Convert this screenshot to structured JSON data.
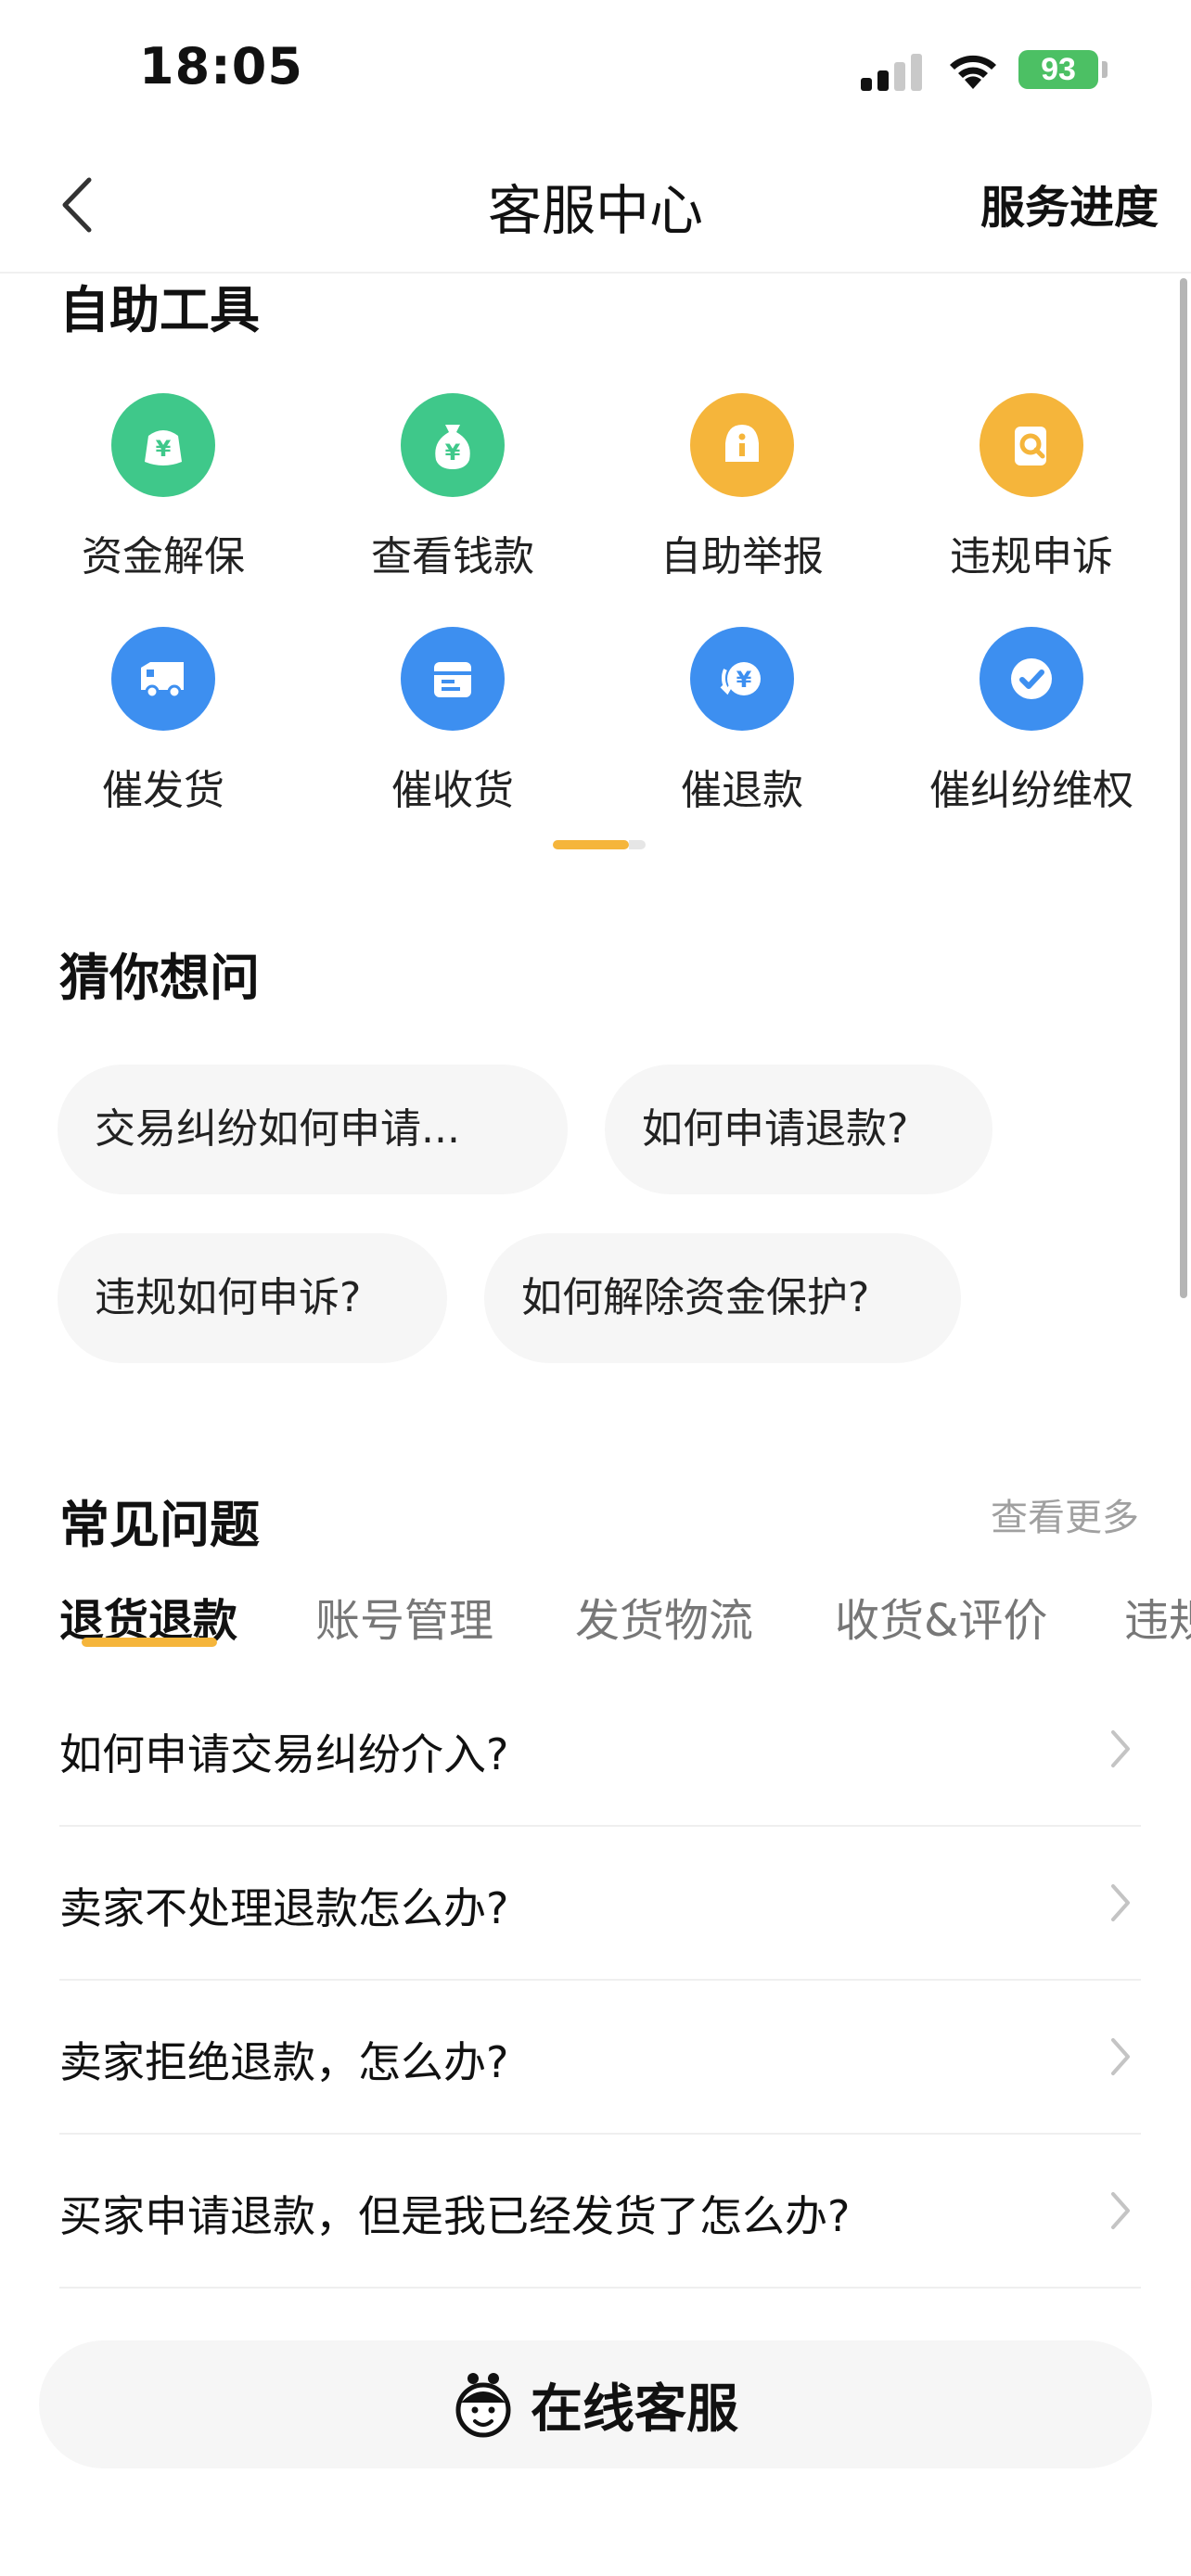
{
  "status_bar": {
    "time": "18:05",
    "battery": "93"
  },
  "nav": {
    "title": "客服中心",
    "progress_label": "服务进度"
  },
  "tools": {
    "title": "自助工具",
    "items": [
      {
        "label": "资金解保",
        "icon": "money-bag-icon",
        "color": "#3fc88a"
      },
      {
        "label": "查看钱款",
        "icon": "money-pouch-icon",
        "color": "#3fc88a"
      },
      {
        "label": "自助举报",
        "icon": "report-icon",
        "color": "#f5b53b"
      },
      {
        "label": "违规申诉",
        "icon": "appeal-icon",
        "color": "#f5b53b"
      },
      {
        "label": "催发货",
        "icon": "truck-icon",
        "color": "#3d8ff0"
      },
      {
        "label": "催收货",
        "icon": "package-icon",
        "color": "#3d8ff0"
      },
      {
        "label": "催退款",
        "icon": "refund-icon",
        "color": "#3d8ff0"
      },
      {
        "label": "催纠纷维权",
        "icon": "check-icon",
        "color": "#3d8ff0"
      }
    ]
  },
  "guess": {
    "title": "猜你想问",
    "chips": [
      "交易纠纷如何申请...",
      "如何申请退款?",
      "违规如何申诉?",
      "如何解除资金保护?"
    ]
  },
  "faq": {
    "title": "常见问题",
    "see_more": "查看更多",
    "tabs": [
      "退货退款",
      "账号管理",
      "发货物流",
      "收货&评价",
      "违规"
    ],
    "questions": [
      "如何申请交易纠纷介入?",
      "卖家不处理退款怎么办?",
      "卖家拒绝退款，怎么办?",
      "买家申请退款，但是我已经发货了怎么办?"
    ]
  },
  "service_button": {
    "label": "在线客服"
  }
}
